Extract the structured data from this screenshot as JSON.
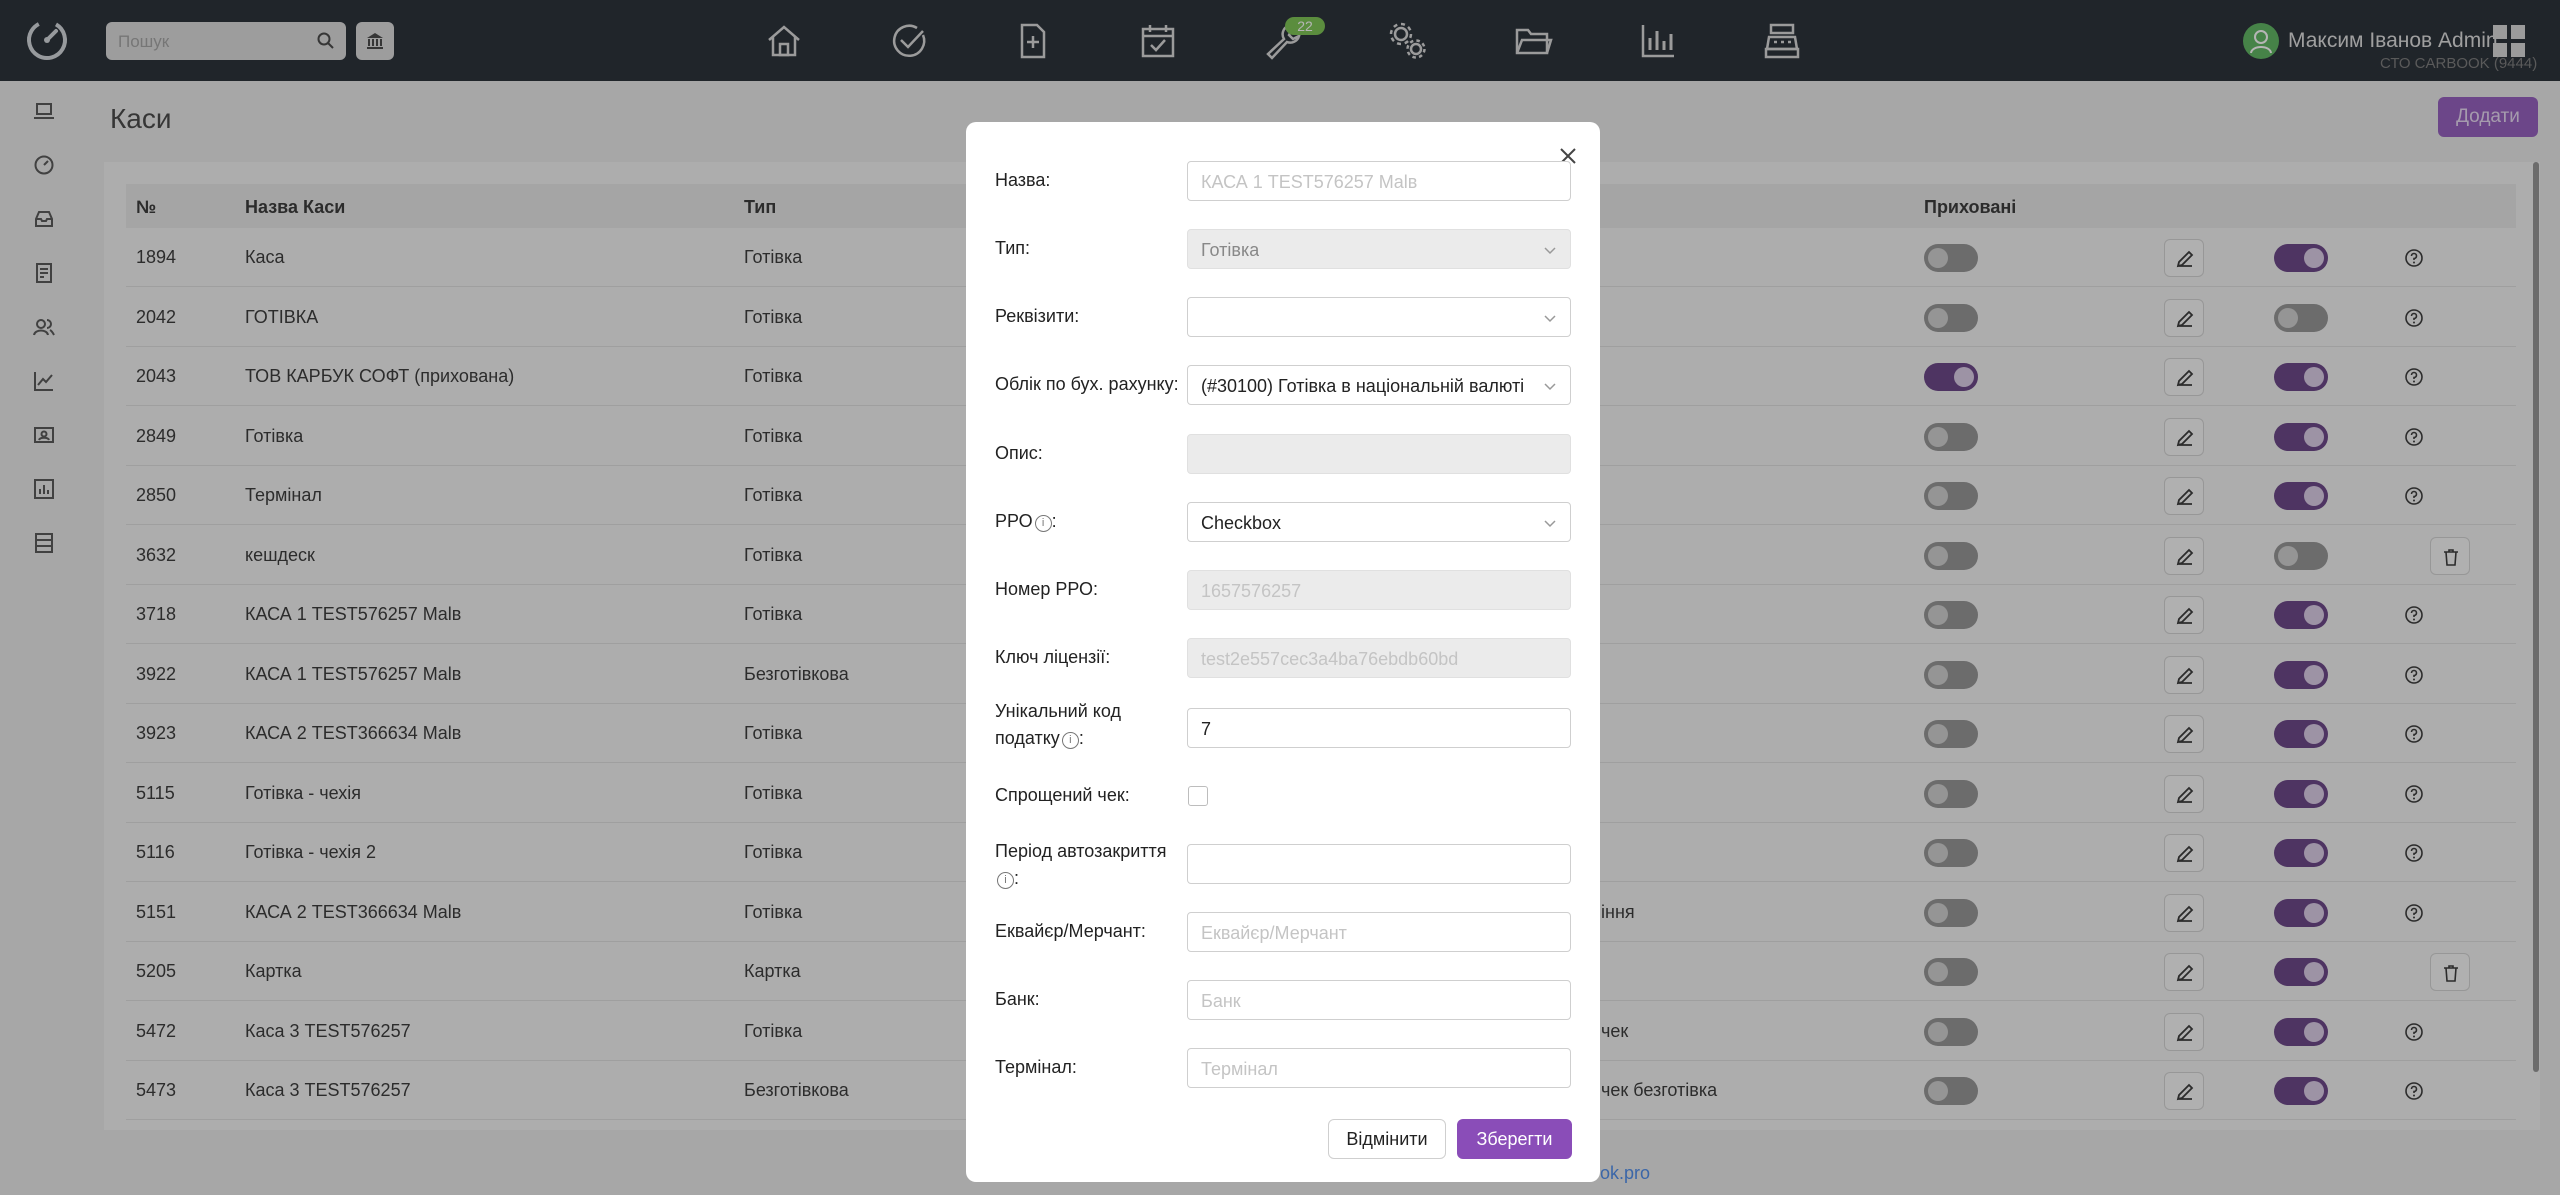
{
  "header": {
    "search_placeholder": "Пошук",
    "badge_count": "22",
    "user_name": "Максим Іванов Admin",
    "company": "СТО CARBOOK (9444)"
  },
  "page": {
    "title": "Каси",
    "add_label": "Додати",
    "footer_link": "ok.pro"
  },
  "table": {
    "headers": {
      "num": "№",
      "name": "Назва Каси",
      "type": "Тип",
      "hidden": "Приховані"
    },
    "rows": [
      {
        "num": "1894",
        "name": "Каса",
        "type": "Готівка",
        "tail": "",
        "hidden": false,
        "active": true,
        "action": "help"
      },
      {
        "num": "2042",
        "name": "ГОТІВКА",
        "type": "Готівка",
        "tail": "",
        "hidden": false,
        "active": false,
        "action": "help"
      },
      {
        "num": "2043",
        "name": "ТОВ КАРБУК СОФТ (прихована)",
        "type": "Готівка",
        "tail": "",
        "hidden": true,
        "active": true,
        "action": "help"
      },
      {
        "num": "2849",
        "name": "Готівка",
        "type": "Готівка",
        "tail": "",
        "hidden": false,
        "active": true,
        "action": "help"
      },
      {
        "num": "2850",
        "name": "Термінал",
        "type": "Готівка",
        "tail": "",
        "hidden": false,
        "active": true,
        "action": "help"
      },
      {
        "num": "3632",
        "name": "кешдеск",
        "type": "Готівка",
        "tail": "",
        "hidden": false,
        "active": false,
        "action": "delete"
      },
      {
        "num": "3718",
        "name": "КАСА 1 TEST576257 Malв",
        "type": "Готівка",
        "tail": "",
        "hidden": false,
        "active": true,
        "action": "help"
      },
      {
        "num": "3922",
        "name": "КАСА 1 TEST576257 Malв",
        "type": "Безготівкова",
        "tail": "",
        "hidden": false,
        "active": true,
        "action": "help"
      },
      {
        "num": "3923",
        "name": "КАСА 2 TEST366634 Malв",
        "type": "Готівка",
        "tail": "",
        "hidden": false,
        "active": true,
        "action": "help"
      },
      {
        "num": "5115",
        "name": "Готівка - чехія",
        "type": "Готівка",
        "tail": "",
        "hidden": false,
        "active": true,
        "action": "help"
      },
      {
        "num": "5116",
        "name": "Готівка - чехія 2",
        "type": "Готівка",
        "tail": "",
        "hidden": false,
        "active": true,
        "action": "help"
      },
      {
        "num": "5151",
        "name": "КАСА 2 TEST366634 Malв",
        "type": "Готівка",
        "tail": "іння",
        "hidden": false,
        "active": true,
        "action": "help"
      },
      {
        "num": "5205",
        "name": "Картка",
        "type": "Картка",
        "tail": "",
        "hidden": false,
        "active": true,
        "action": "delete"
      },
      {
        "num": "5472",
        "name": "Каса 3 TEST576257",
        "type": "Готівка",
        "tail": "чек",
        "hidden": false,
        "active": true,
        "action": "help"
      },
      {
        "num": "5473",
        "name": "Каса 3 TEST576257",
        "type": "Безготівкова",
        "tail": "чек безготівка",
        "hidden": false,
        "active": true,
        "action": "help"
      }
    ]
  },
  "modal": {
    "name_label": "Назва:",
    "name_value": "КАСА 1 TEST576257 Malв",
    "type_label": "Тип:",
    "type_value": "Готівка",
    "requisites_label": "Реквізити:",
    "requisites_value": "",
    "account_label": "Облік по бух. рахунку:",
    "account_value": "(#30100) Готівка в національній валюті",
    "description_label": "Опис:",
    "description_value": "",
    "rro_label": "РРО",
    "rro_value": "Checkbox",
    "rro_number_label": "Номер РРО:",
    "rro_number_value": "1657576257",
    "license_label": "Ключ ліцензії:",
    "license_value": "test2e557cec3a4ba76ebdb60bd",
    "tax_code_label_1": "Унікальний код",
    "tax_code_label_2": "податку",
    "tax_code_value": "7",
    "simple_check_label": "Спрощений чек:",
    "autoclose_label": "Період автозакриття",
    "autoclose_value": "",
    "acquirer_label": "Еквайєр/Мерчант:",
    "acquirer_placeholder": "Еквайєр/Мерчант",
    "bank_label": "Банк:",
    "bank_placeholder": "Банк",
    "terminal_label": "Термінал:",
    "terminal_placeholder": "Термінал",
    "cancel_label": "Відмінити",
    "save_label": "Зберегти",
    "info_glyph": "i"
  },
  "colors": {
    "accent": "#8a4db8",
    "topbar": "#0f1720",
    "toggle_on": "#5a2f7a",
    "badge": "#6fbf3f"
  }
}
